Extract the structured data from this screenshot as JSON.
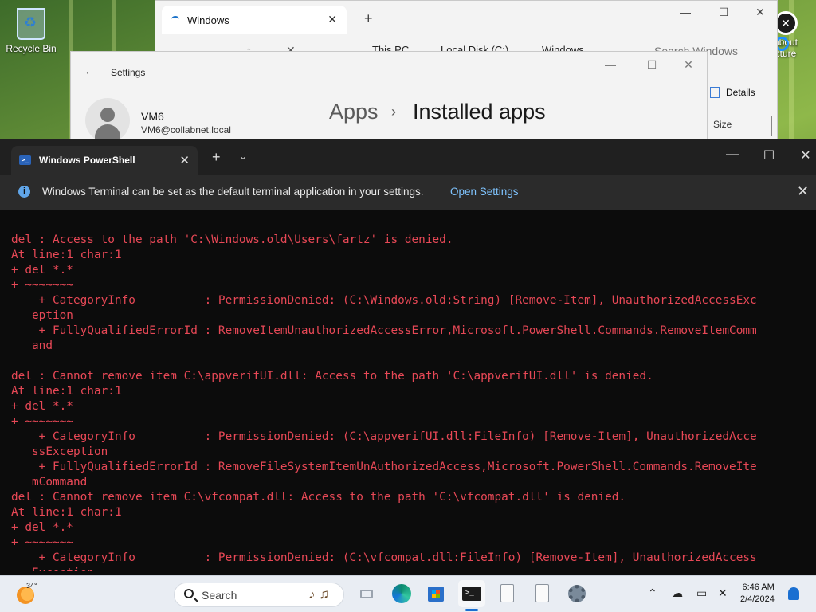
{
  "desktop": {
    "recycle_bin_label": "Recycle Bin",
    "about_label_1": "about",
    "about_label_2": "cture"
  },
  "explorer": {
    "tab_title": "Windows",
    "breadcrumb": [
      "This PC",
      "Local Disk (C:)",
      "Windows"
    ],
    "search_placeholder": "Search Windows",
    "details_label": "Details",
    "size_column": "Size"
  },
  "settings": {
    "title": "Settings",
    "user_name": "VM6",
    "user_email": "VM6@collabnet.local",
    "breadcrumb_parent": "Apps",
    "breadcrumb_separator": "›",
    "breadcrumb_current": "Installed apps"
  },
  "terminal": {
    "tab_title": "Windows PowerShell",
    "infobar_message": "Windows Terminal can be set as the default terminal application in your settings.",
    "infobar_link": "Open Settings",
    "error_color": "#e74856",
    "lines": [
      "del : Access to the path 'C:\\Windows.old\\Users\\fartz' is denied.",
      "At line:1 char:1",
      "+ del *.*",
      "+ ~~~~~~~",
      "    + CategoryInfo          : PermissionDenied: (C:\\Windows.old:String) [Remove-Item], UnauthorizedAccessExc",
      "   eption",
      "    + FullyQualifiedErrorId : RemoveItemUnauthorizedAccessError,Microsoft.PowerShell.Commands.RemoveItemComm",
      "   and",
      "",
      "del : Cannot remove item C:\\appverifUI.dll: Access to the path 'C:\\appverifUI.dll' is denied.",
      "At line:1 char:1",
      "+ del *.*",
      "+ ~~~~~~~",
      "    + CategoryInfo          : PermissionDenied: (C:\\appverifUI.dll:FileInfo) [Remove-Item], UnauthorizedAcce",
      "   ssException",
      "    + FullyQualifiedErrorId : RemoveFileSystemItemUnAuthorizedAccess,Microsoft.PowerShell.Commands.RemoveIte",
      "   mCommand",
      "del : Cannot remove item C:\\vfcompat.dll: Access to the path 'C:\\vfcompat.dll' is denied.",
      "At line:1 char:1",
      "+ del *.*",
      "+ ~~~~~~~",
      "    + CategoryInfo          : PermissionDenied: (C:\\vfcompat.dll:FileInfo) [Remove-Item], UnauthorizedAccess",
      "   Exception"
    ]
  },
  "taskbar": {
    "temperature": "34°",
    "search_placeholder": "Search",
    "time": "6:46 AM",
    "date": "2/4/2024",
    "accent_color": "#1a6fd1"
  }
}
